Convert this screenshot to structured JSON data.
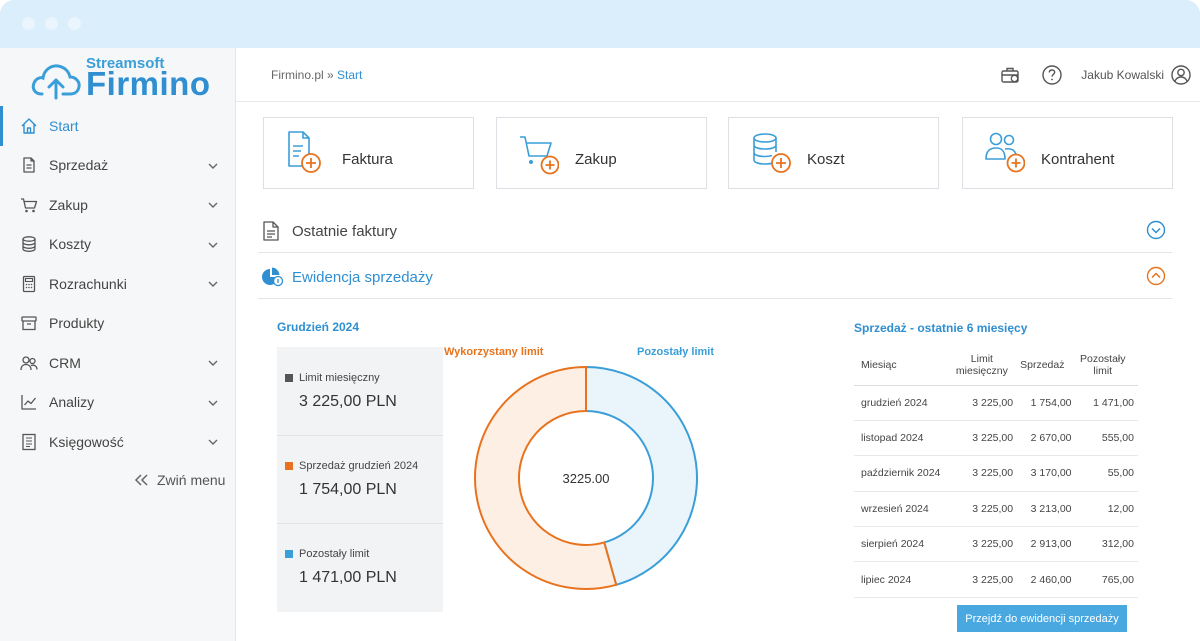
{
  "app": {
    "logo_top": "Streamsoft",
    "logo_main": "Firmino"
  },
  "breadcrumb": {
    "root": "Firmino.pl",
    "separator": " » ",
    "current": "Start"
  },
  "topbar": {
    "user_name": "Jakub Kowalski",
    "icons": [
      "briefcase-icon",
      "help-icon",
      "user-icon"
    ]
  },
  "sidebar": {
    "items": [
      {
        "label": "Start",
        "icon": "home-icon",
        "active": true,
        "expandable": false
      },
      {
        "label": "Sprzedaż",
        "icon": "invoice-icon",
        "active": false,
        "expandable": true
      },
      {
        "label": "Zakup",
        "icon": "cart-icon",
        "active": false,
        "expandable": true
      },
      {
        "label": "Koszty",
        "icon": "coins-icon",
        "active": false,
        "expandable": true
      },
      {
        "label": "Rozrachunki",
        "icon": "calculator-icon",
        "active": false,
        "expandable": true
      },
      {
        "label": "Produkty",
        "icon": "box-icon",
        "active": false,
        "expandable": false
      },
      {
        "label": "CRM",
        "icon": "crm-icon",
        "active": false,
        "expandable": true
      },
      {
        "label": "Analizy",
        "icon": "chart-icon",
        "active": false,
        "expandable": true
      },
      {
        "label": "Księgowość",
        "icon": "ledger-icon",
        "active": false,
        "expandable": true
      }
    ],
    "collapse_label": "Zwiń menu"
  },
  "quick_actions": [
    {
      "label": "Faktura",
      "icon": "invoice-add-icon"
    },
    {
      "label": "Zakup",
      "icon": "cart-add-icon"
    },
    {
      "label": "Koszt",
      "icon": "coins-add-icon"
    },
    {
      "label": "Kontrahent",
      "icon": "contacts-add-icon"
    }
  ],
  "sections": {
    "recent_invoices": {
      "title": "Ostatnie faktury",
      "expanded": false
    },
    "sales_register": {
      "title": "Ewidencja sprzedaży",
      "expanded": true
    }
  },
  "month_summary": {
    "title": "Grudzień 2024",
    "stats": [
      {
        "label": "Limit miesięczny",
        "value": "3 225,00 PLN",
        "color": "#555555"
      },
      {
        "label": "Sprzedaż grudzień 2024",
        "value": "1 754,00 PLN",
        "color": "#e8731e"
      },
      {
        "label": "Pozostały limit",
        "value": "1 471,00 PLN",
        "color": "#3a9fd8"
      }
    ]
  },
  "chart_data": {
    "type": "pie",
    "labels": [
      "Wykorzystany limit",
      "Pozostały limit"
    ],
    "values": [
      1754.0,
      1471.0
    ],
    "colors": [
      "#e8731e",
      "#3a9fd8"
    ],
    "fills": [
      "#fdefe4",
      "#eaf4fb"
    ],
    "center_label": "3225.00"
  },
  "sales_table": {
    "title": "Sprzedaż - ostatnie 6 miesięcy",
    "headers": [
      "Miesiąc",
      "Limit miesięczny",
      "Sprzedaż",
      "Pozostały limit"
    ],
    "rows": [
      [
        "grudzień 2024",
        "3 225,00",
        "1 754,00",
        "1 471,00"
      ],
      [
        "listopad 2024",
        "3 225,00",
        "2 670,00",
        "555,00"
      ],
      [
        "październik 2024",
        "3 225,00",
        "3 170,00",
        "55,00"
      ],
      [
        "wrzesień 2024",
        "3 225,00",
        "3 213,00",
        "12,00"
      ],
      [
        "sierpień 2024",
        "3 225,00",
        "2 913,00",
        "312,00"
      ],
      [
        "lipiec 2024",
        "3 225,00",
        "2 460,00",
        "765,00"
      ]
    ],
    "button_label": "Przejdź do ewidencji sprzedaży"
  }
}
